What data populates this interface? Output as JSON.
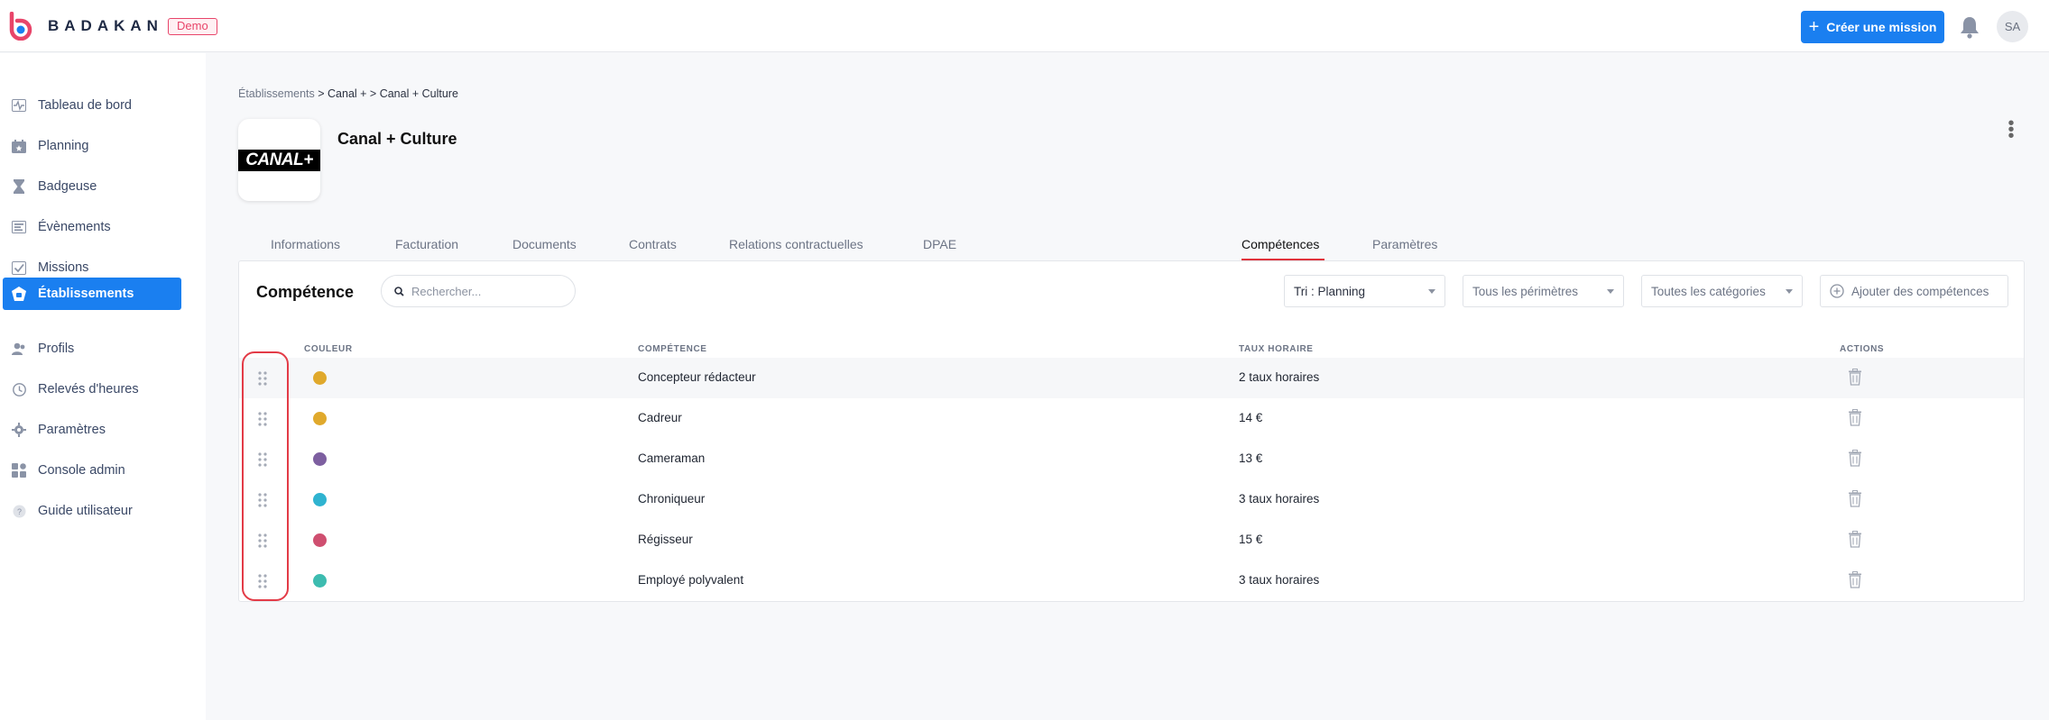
{
  "header": {
    "brand": "BADAKAN",
    "demo_badge": "Demo",
    "create_button": "Créer une mission",
    "avatar_initials": "SA",
    "accent_color": "#1a7ff0"
  },
  "sidebar": {
    "items": [
      {
        "label": "Tableau de bord",
        "icon": "pulse-icon"
      },
      {
        "label": "Planning",
        "icon": "calendar-icon"
      },
      {
        "label": "Badgeuse",
        "icon": "hourglass-icon"
      },
      {
        "label": "Évènements",
        "icon": "list-icon"
      },
      {
        "label": "Missions",
        "icon": "checkbox-icon"
      },
      {
        "label": "Établissements",
        "icon": "building-icon",
        "active": true
      },
      {
        "label": "Profils",
        "icon": "users-icon"
      },
      {
        "label": "Relevés d'heures",
        "icon": "clock-icon"
      },
      {
        "label": "Paramètres",
        "icon": "gear-icon"
      },
      {
        "label": "Console admin",
        "icon": "grid-icon"
      },
      {
        "label": "Guide utilisateur",
        "icon": "help-icon"
      }
    ]
  },
  "breadcrumb": {
    "part1": "Établissements",
    "sep1": " > ",
    "part2": "Canal +",
    "sep2": " > ",
    "part3": "Canal + Culture"
  },
  "company": {
    "logo_text": "CANAL+",
    "title": "Canal + Culture"
  },
  "tabs": [
    {
      "label": "Informations"
    },
    {
      "label": "Facturation"
    },
    {
      "label": "Documents"
    },
    {
      "label": "Contrats"
    },
    {
      "label": "Relations contractuelles"
    },
    {
      "label": "DPAE"
    },
    {
      "label": "Compétences",
      "active": true
    },
    {
      "label": "Paramètres"
    }
  ],
  "panel": {
    "title": "Compétence",
    "search_placeholder": "Rechercher...",
    "sort_select": "Tri : Planning",
    "perimeter_select": "Tous les périmètres",
    "category_select": "Toutes les catégories",
    "add_button": "Ajouter des compétences"
  },
  "table": {
    "headers": {
      "color": "COULEUR",
      "skill": "COMPÉTENCE",
      "rate": "TAUX HORAIRE",
      "actions": "ACTIONS"
    },
    "rows": [
      {
        "color": "#e0a92c",
        "skill": "Concepteur rédacteur",
        "rate": "2 taux horaires"
      },
      {
        "color": "#e0a92c",
        "skill": "Cadreur",
        "rate": "14 €"
      },
      {
        "color": "#7d5fa0",
        "skill": "Cameraman",
        "rate": "13 €"
      },
      {
        "color": "#2fb3d0",
        "skill": "Chroniqueur",
        "rate": "3 taux horaires"
      },
      {
        "color": "#cf4f70",
        "skill": "Régisseur",
        "rate": "15 €"
      },
      {
        "color": "#3dbcb0",
        "skill": "Employé polyvalent",
        "rate": "3 taux horaires"
      }
    ]
  }
}
